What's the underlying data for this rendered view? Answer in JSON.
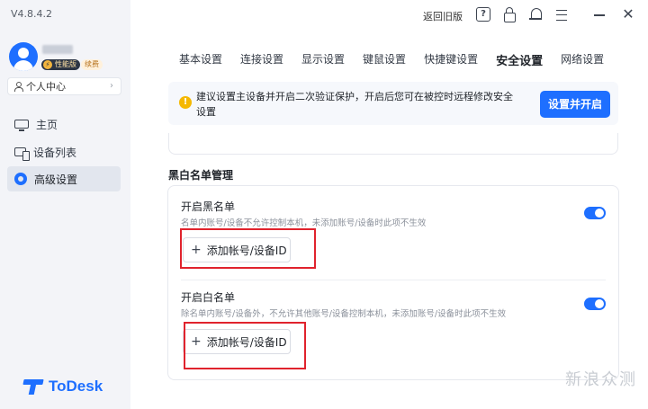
{
  "app": {
    "version": "V4.8.4.2",
    "brand": "ToDesk",
    "accent_color": "#1e6fff"
  },
  "user": {
    "vip_badge": "性能版",
    "renew_badge": "续费",
    "personal_center": "个人中心"
  },
  "sidebar": {
    "items": [
      {
        "label": "主页",
        "icon": "monitor-icon"
      },
      {
        "label": "设备列表",
        "icon": "devices-icon"
      },
      {
        "label": "高级设置",
        "icon": "gear-icon",
        "active": true
      }
    ]
  },
  "titlebar": {
    "old_version": "返回旧版",
    "icons": [
      "help-icon",
      "lock-icon",
      "bell-icon",
      "menu-icon",
      "minimize-icon",
      "close-icon"
    ]
  },
  "tabs": [
    {
      "label": "基本设置"
    },
    {
      "label": "连接设置"
    },
    {
      "label": "显示设置"
    },
    {
      "label": "键鼠设置"
    },
    {
      "label": "快捷键设置"
    },
    {
      "label": "安全设置",
      "active": true
    },
    {
      "label": "网络设置"
    }
  ],
  "notice": {
    "text": "建议设置主设备并开启二次验证保护，开启后您可在被控时远程修改安全设置",
    "button": "设置并开启"
  },
  "blackwhite": {
    "section_title": "黑白名单管理",
    "blacklist": {
      "title": "开启黑名单",
      "desc": "名单内账号/设备不允许控制本机，未添加账号/设备时此项不生效",
      "add_label": "添加帐号/设备ID",
      "enabled": true
    },
    "whitelist": {
      "title": "开启白名单",
      "desc": "除名单内账号/设备外，不允许其他账号/设备控制本机，未添加账号/设备时此项不生效",
      "add_label": "添加帐号/设备ID",
      "enabled": true
    }
  },
  "watermark": "新浪众测"
}
